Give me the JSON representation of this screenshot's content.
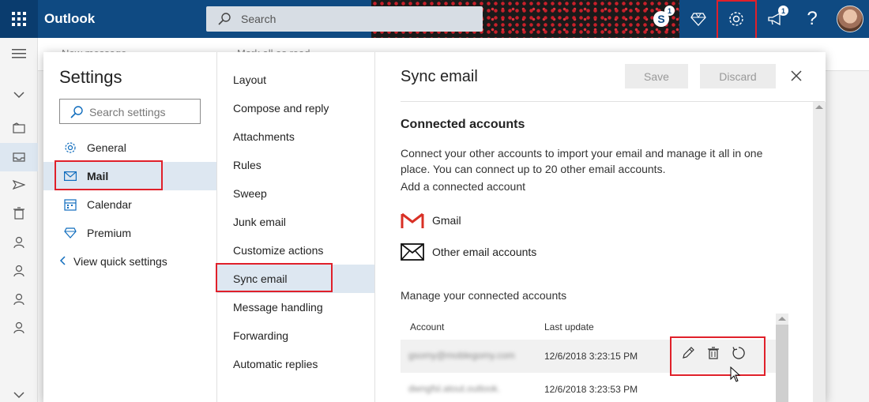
{
  "app": {
    "name": "Outlook"
  },
  "topbar": {
    "search_placeholder": "Search",
    "skype_badge": "1",
    "notification_badge": "1"
  },
  "background": {
    "command_1": "New message",
    "command_2": "Mark all as read"
  },
  "settings": {
    "title": "Settings",
    "search_placeholder": "Search settings",
    "categories": [
      {
        "label": "General",
        "icon": "gear-icon"
      },
      {
        "label": "Mail",
        "icon": "mail-icon",
        "selected": true
      },
      {
        "label": "Calendar",
        "icon": "calendar-icon"
      },
      {
        "label": "Premium",
        "icon": "diamond-icon"
      }
    ],
    "view_quick": "View quick settings"
  },
  "mail_nav": {
    "items": [
      "Layout",
      "Compose and reply",
      "Attachments",
      "Rules",
      "Sweep",
      "Junk email",
      "Customize actions",
      "Sync email",
      "Message handling",
      "Forwarding",
      "Automatic replies"
    ],
    "selected": "Sync email"
  },
  "pane": {
    "title": "Sync email",
    "save_label": "Save",
    "discard_label": "Discard",
    "connected_heading": "Connected accounts",
    "description": "Connect your other accounts to import your email and manage it all in one place. You can connect up to 20 other email accounts.",
    "add_label": "Add a connected account",
    "providers": [
      {
        "label": "Gmail",
        "icon": "gmail-icon"
      },
      {
        "label": "Other email accounts",
        "icon": "envelope-icon"
      }
    ],
    "manage_label": "Manage your connected accounts",
    "table": {
      "headers": {
        "account": "Account",
        "last_update": "Last update"
      },
      "rows": [
        {
          "account": "gsomy@moblegomy.com",
          "last_update": "12/6/2018 3:23:15 PM"
        },
        {
          "account": "dwngfsl.atout.outlook.",
          "last_update": "12/6/2018 3:23:53 PM"
        }
      ]
    }
  },
  "colors": {
    "brand": "#0f4a82",
    "highlight": "#e0202a",
    "selection": "#dde7f1"
  }
}
